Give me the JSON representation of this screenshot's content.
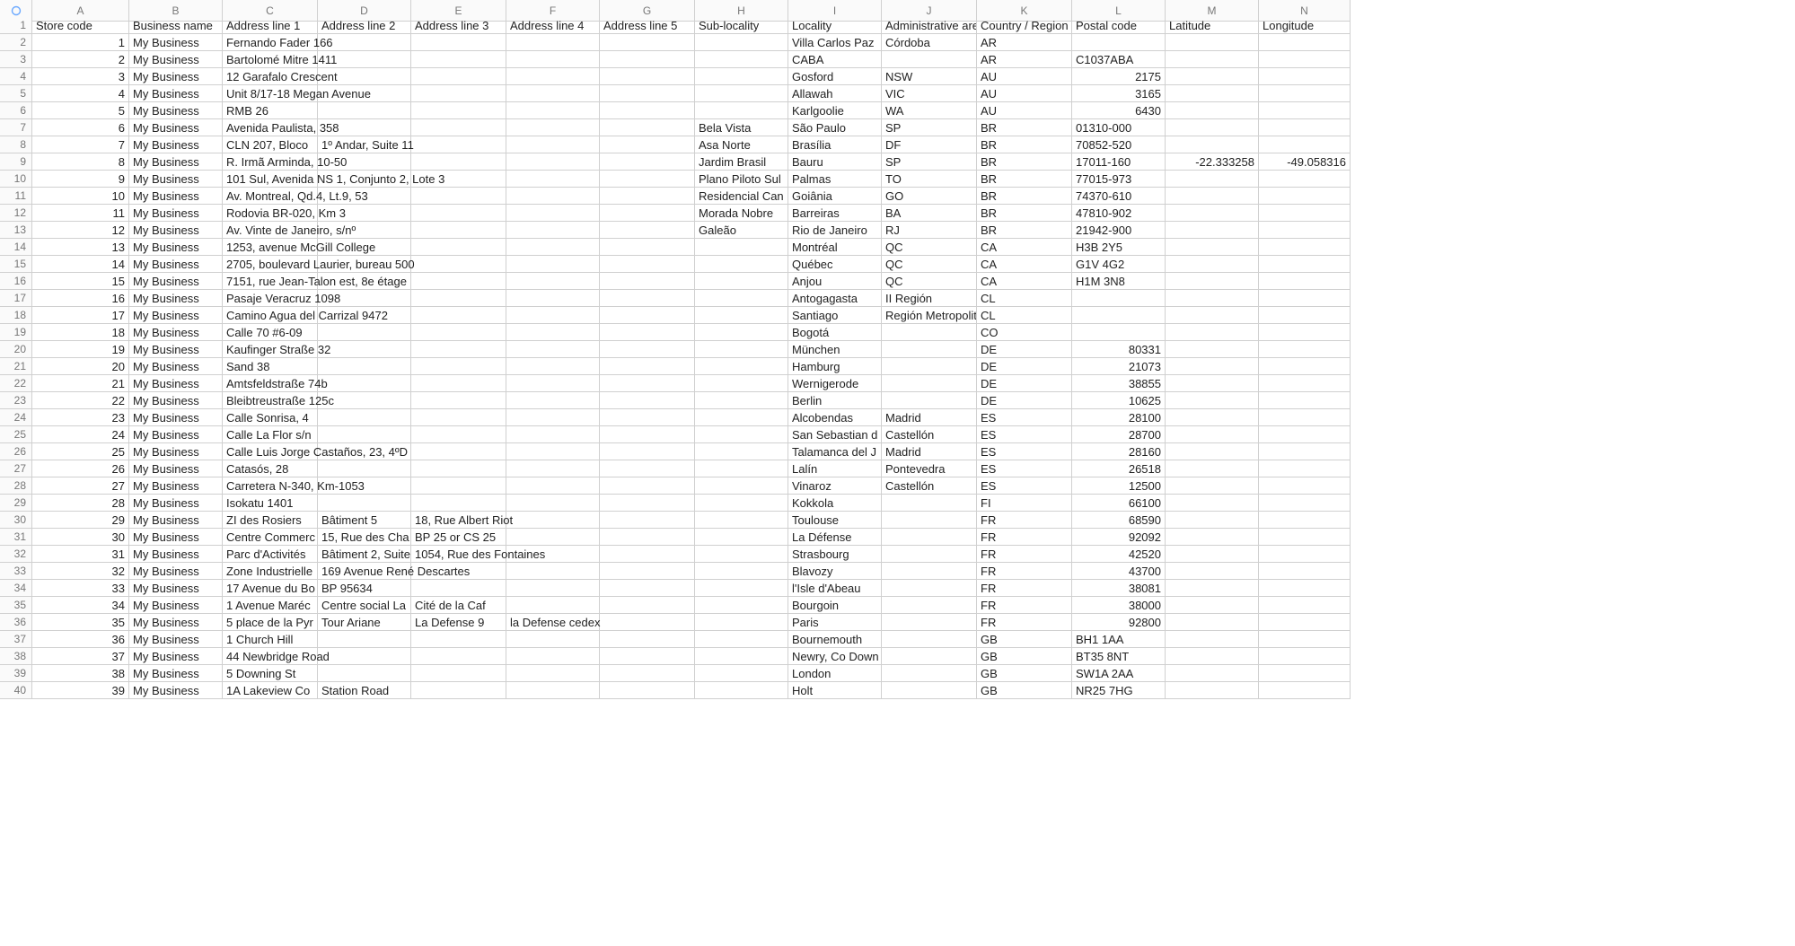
{
  "columns": [
    "A",
    "B",
    "C",
    "D",
    "E",
    "F",
    "G",
    "H",
    "I",
    "J",
    "K",
    "L",
    "M",
    "N"
  ],
  "headers": [
    "Store code",
    "Business name",
    "Address line 1",
    "Address line 2",
    "Address line 3",
    "Address line 4",
    "Address line 5",
    "Sub-locality",
    "Locality",
    "Administrative area",
    "Country / Region",
    "Postal code",
    "Latitude",
    "Longitude"
  ],
  "numeric_columns": [
    0,
    11,
    12,
    13
  ],
  "rows": [
    [
      "1",
      "My Business",
      "Fernando Fader 166",
      "",
      "",
      "",
      "",
      "",
      "Villa Carlos Paz",
      "Córdoba",
      "AR",
      "",
      "",
      ""
    ],
    [
      "2",
      "My Business",
      "Bartolomé Mitre 1411",
      "",
      "",
      "",
      "",
      "",
      "CABA",
      "",
      "AR",
      "C1037ABA",
      "",
      ""
    ],
    [
      "3",
      "My Business",
      "12 Garafalo Crescent",
      "",
      "",
      "",
      "",
      "",
      "Gosford",
      "NSW",
      "AU",
      "2175",
      "",
      ""
    ],
    [
      "4",
      "My Business",
      "Unit 8/17-18 Megan Avenue",
      "",
      "",
      "",
      "",
      "",
      "Allawah",
      "VIC",
      "AU",
      "3165",
      "",
      ""
    ],
    [
      "5",
      "My Business",
      "RMB 26",
      "",
      "",
      "",
      "",
      "",
      "Karlgoolie",
      "WA",
      "AU",
      "6430",
      "",
      ""
    ],
    [
      "6",
      "My Business",
      "Avenida Paulista, 358",
      "",
      "",
      "",
      "",
      "Bela Vista",
      "São Paulo",
      "SP",
      "BR",
      "01310-000",
      "",
      ""
    ],
    [
      "7",
      "My Business",
      "CLN 207, Bloco",
      "1º Andar, Suite 11",
      "",
      "",
      "",
      "Asa Norte",
      "Brasília",
      "DF",
      "BR",
      "70852-520",
      "",
      ""
    ],
    [
      "8",
      "My Business",
      "R. Irmã Arminda, 10-50",
      "",
      "",
      "",
      "",
      "Jardim Brasil",
      "Bauru",
      "SP",
      "BR",
      "17011-160",
      "-22.333258",
      "-49.058316"
    ],
    [
      "9",
      "My Business",
      "101 Sul, Avenida NS 1, Conjunto 2, Lote 3",
      "",
      "",
      "",
      "",
      "Plano Piloto Sul",
      "Palmas",
      "TO",
      "BR",
      "77015-973",
      "",
      ""
    ],
    [
      "10",
      "My Business",
      "Av. Montreal, Qd.4, Lt.9, 53",
      "",
      "",
      "",
      "",
      "Residencial Can",
      "Goiânia",
      "GO",
      "BR",
      "74370-610",
      "",
      ""
    ],
    [
      "11",
      "My Business",
      "Rodovia BR-020, Km 3",
      "",
      "",
      "",
      "",
      "Morada Nobre",
      "Barreiras",
      "BA",
      "BR",
      "47810-902",
      "",
      ""
    ],
    [
      "12",
      "My Business",
      "Av. Vinte de Janeiro, s/nº",
      "",
      "",
      "",
      "",
      "Galeão",
      "Rio de Janeiro",
      "RJ",
      "BR",
      "21942-900",
      "",
      ""
    ],
    [
      "13",
      "My Business",
      "1253, avenue McGill College",
      "",
      "",
      "",
      "",
      "",
      "Montréal",
      "QC",
      "CA",
      "H3B 2Y5",
      "",
      ""
    ],
    [
      "14",
      "My Business",
      "2705, boulevard Laurier, bureau 500",
      "",
      "",
      "",
      "",
      "",
      "Québec",
      "QC",
      "CA",
      "G1V 4G2",
      "",
      ""
    ],
    [
      "15",
      "My Business",
      "7151, rue Jean-Talon est, 8e étage",
      "",
      "",
      "",
      "",
      "",
      "Anjou",
      "QC",
      "CA",
      "H1M 3N8",
      "",
      ""
    ],
    [
      "16",
      "My Business",
      "Pasaje Veracruz 1098",
      "",
      "",
      "",
      "",
      "",
      "Antogagasta",
      "II Región",
      "CL",
      "",
      "",
      ""
    ],
    [
      "17",
      "My Business",
      "Camino Agua del Carrizal 9472",
      "",
      "",
      "",
      "",
      "",
      "Santiago",
      "Región Metropolitana",
      "CL",
      "",
      "",
      ""
    ],
    [
      "18",
      "My Business",
      "Calle 70 #6-09",
      "",
      "",
      "",
      "",
      "",
      "Bogotá",
      "",
      "CO",
      "",
      "",
      ""
    ],
    [
      "19",
      "My Business",
      "Kaufinger Straße 32",
      "",
      "",
      "",
      "",
      "",
      "München",
      "",
      "DE",
      "80331",
      "",
      ""
    ],
    [
      "20",
      "My Business",
      "Sand 38",
      "",
      "",
      "",
      "",
      "",
      "Hamburg",
      "",
      "DE",
      "21073",
      "",
      ""
    ],
    [
      "21",
      "My Business",
      "Amtsfeldstraße 74b",
      "",
      "",
      "",
      "",
      "",
      "Wernigerode",
      "",
      "DE",
      "38855",
      "",
      ""
    ],
    [
      "22",
      "My Business",
      "Bleibtreustraße 125c",
      "",
      "",
      "",
      "",
      "",
      "Berlin",
      "",
      "DE",
      "10625",
      "",
      ""
    ],
    [
      "23",
      "My Business",
      "Calle Sonrisa, 4",
      "",
      "",
      "",
      "",
      "",
      "Alcobendas",
      "Madrid",
      "ES",
      "28100",
      "",
      ""
    ],
    [
      "24",
      "My Business",
      "Calle La Flor s/n",
      "",
      "",
      "",
      "",
      "",
      "San Sebastian d",
      "Castellón",
      "ES",
      "28700",
      "",
      ""
    ],
    [
      "25",
      "My Business",
      "Calle Luis Jorge Castaños, 23, 4ºD",
      "",
      "",
      "",
      "",
      "",
      "Talamanca del J",
      "Madrid",
      "ES",
      "28160",
      "",
      ""
    ],
    [
      "26",
      "My Business",
      "Catasós, 28",
      "",
      "",
      "",
      "",
      "",
      "Lalín",
      "Pontevedra",
      "ES",
      "26518",
      "",
      ""
    ],
    [
      "27",
      "My Business",
      "Carretera N-340, Km-1053",
      "",
      "",
      "",
      "",
      "",
      "Vinaroz",
      "Castellón",
      "ES",
      "12500",
      "",
      ""
    ],
    [
      "28",
      "My Business",
      "Isokatu 1401",
      "",
      "",
      "",
      "",
      "",
      "Kokkola",
      "",
      "FI",
      "66100",
      "",
      ""
    ],
    [
      "29",
      "My Business",
      "ZI des Rosiers",
      "Bâtiment 5",
      "18, Rue Albert Riot",
      "",
      "",
      "",
      "Toulouse",
      "",
      "FR",
      "68590",
      "",
      ""
    ],
    [
      "30",
      "My Business",
      "Centre Commerc",
      "15, Rue des Cha",
      "BP 25 or CS 25",
      "",
      "",
      "",
      "La Défense",
      "",
      "FR",
      "92092",
      "",
      ""
    ],
    [
      "31",
      "My Business",
      "Parc d'Activités",
      "Bâtiment 2, Suite",
      "1054, Rue des Fontaines",
      "",
      "",
      "",
      "Strasbourg",
      "",
      "FR",
      "42520",
      "",
      ""
    ],
    [
      "32",
      "My Business",
      "Zone Industrielle",
      "169 Avenue René Descartes",
      "",
      "",
      "",
      "",
      "Blavozy",
      "",
      "FR",
      "43700",
      "",
      ""
    ],
    [
      "33",
      "My Business",
      "17 Avenue du Bo",
      "BP 95634",
      "",
      "",
      "",
      "",
      "l'Isle d'Abeau",
      "",
      "FR",
      "38081",
      "",
      ""
    ],
    [
      "34",
      "My Business",
      "1 Avenue Maréc",
      "Centre social La",
      "Cité de la Caf",
      "",
      "",
      "",
      "Bourgoin",
      "",
      "FR",
      "38000",
      "",
      ""
    ],
    [
      "35",
      "My Business",
      "5 place de la Pyr",
      "Tour Ariane",
      "La Defense 9",
      "la Defense cedex",
      "",
      "",
      "Paris",
      "",
      "FR",
      "92800",
      "",
      ""
    ],
    [
      "36",
      "My Business",
      "1 Church Hill",
      "",
      "",
      "",
      "",
      "",
      "Bournemouth",
      "",
      "GB",
      "BH1 1AA",
      "",
      ""
    ],
    [
      "37",
      "My Business",
      "44 Newbridge Road",
      "",
      "",
      "",
      "",
      "",
      "Newry, Co Down",
      "",
      "GB",
      "BT35 8NT",
      "",
      ""
    ],
    [
      "38",
      "My Business",
      "5 Downing St",
      "",
      "",
      "",
      "",
      "",
      "London",
      "",
      "GB",
      "SW1A 2AA",
      "",
      ""
    ],
    [
      "39",
      "My Business",
      "1A Lakeview Co",
      "Station Road",
      "",
      "",
      "",
      "",
      "Holt",
      "",
      "GB",
      "NR25 7HG",
      "",
      ""
    ]
  ]
}
